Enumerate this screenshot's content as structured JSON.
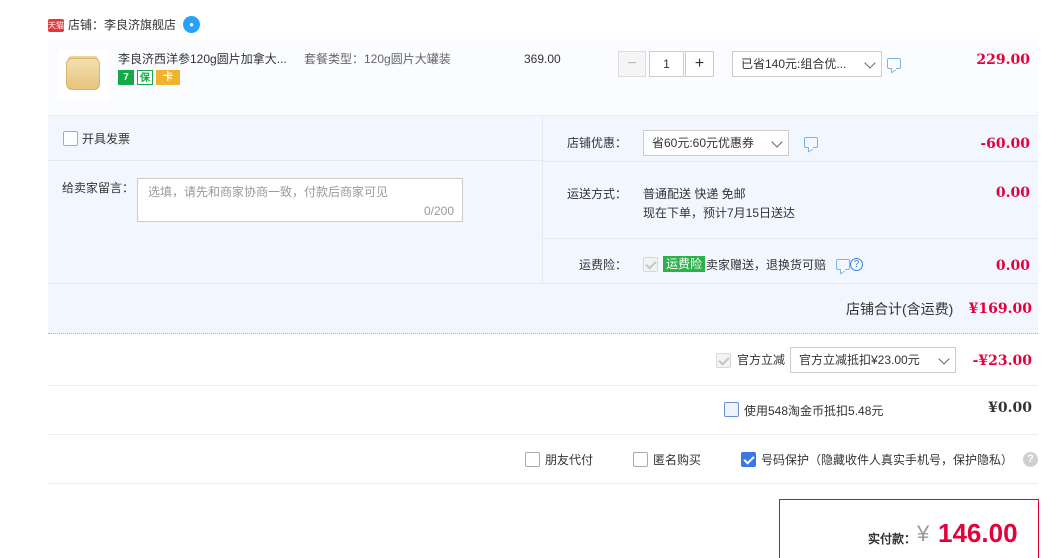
{
  "store": {
    "badge": "天猫",
    "label": "店铺：李良济旗舰店"
  },
  "item": {
    "title": "李良济西洋参120g圆片加拿大...",
    "icons": [
      "7",
      "保",
      "卡"
    ],
    "sku": "套餐类型：120g圆片大罐装",
    "unit_price": "369.00",
    "qty_minus": "−",
    "qty": "1",
    "qty_plus": "+",
    "discount_select": "已省140元:组合优...",
    "subtotal": "229.00"
  },
  "invoice": {
    "label": "开具发票"
  },
  "message": {
    "label": "给卖家留言：",
    "placeholder": "选填，请先和商家协商一致，付款后商家可见",
    "count": "0/200"
  },
  "store_discount": {
    "label": "店铺优惠：",
    "select": "省60元:60元优惠券",
    "amount": "-60.00"
  },
  "shipping": {
    "label": "运送方式：",
    "method": "普通配送 快递 免邮",
    "eta": "现在下单，预计7月15日送达",
    "amount": "0.00"
  },
  "freight_insurance": {
    "label": "运费险：",
    "tag": "运费险",
    "desc": "卖家赠送，退换货可赔",
    "help": "?",
    "amount": "0.00"
  },
  "store_total": {
    "label": "店铺合计(含运费)",
    "amount": "¥169.00"
  },
  "official": {
    "label": "官方立减",
    "select": "官方立减抵扣¥23.00元",
    "amount": "-¥23.00"
  },
  "coins": {
    "label": "使用548淘金币抵扣5.48元",
    "amount": "¥0.00"
  },
  "options": {
    "friend_pay": "朋友代付",
    "anonymous": "匿名购买",
    "privacy": "号码保护（隐藏收件人真实手机号，保护隐私）",
    "help": "?"
  },
  "payment": {
    "label": "实付款：",
    "currency": "¥",
    "amount": "146.00"
  },
  "colors": {
    "accent_red": "#e4003a",
    "panel_bg": "#f2f7ff",
    "check_blue": "#3b78e7"
  }
}
